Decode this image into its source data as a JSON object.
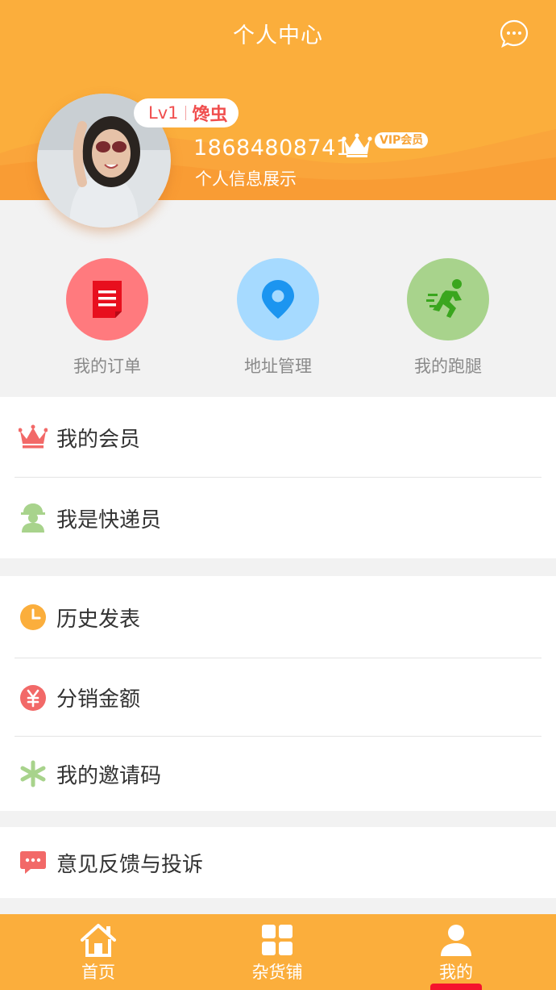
{
  "header": {
    "title": "个人中心",
    "message_icon": "chat-bubble-icon"
  },
  "profile": {
    "level": "Lv1",
    "nickname": "馋虫",
    "phone": "18684808741",
    "vip_badge": "VIP会员",
    "info": "个人信息展示"
  },
  "shortcuts": [
    {
      "label": "我的订单",
      "icon": "order-document-icon",
      "color": "#ff7a7e"
    },
    {
      "label": "地址管理",
      "icon": "location-pin-icon",
      "color": "#a6daff"
    },
    {
      "label": "我的跑腿",
      "icon": "running-man-icon",
      "color": "#a8d38c"
    }
  ],
  "menu": {
    "group1": [
      {
        "label": "我的会员",
        "icon": "crown-icon"
      },
      {
        "label": "我是快递员",
        "icon": "courier-icon"
      }
    ],
    "group2": [
      {
        "label": "历史发表",
        "icon": "clock-icon"
      },
      {
        "label": "分销金额",
        "icon": "yen-icon"
      },
      {
        "label": "我的邀请码",
        "icon": "asterisk-icon"
      }
    ],
    "group3": [
      {
        "label": "意见反馈与投诉",
        "icon": "feedback-chat-icon"
      }
    ]
  },
  "tabbar": [
    {
      "label": "首页",
      "icon": "home-icon",
      "active": false
    },
    {
      "label": "杂货铺",
      "icon": "grid-icon",
      "active": false
    },
    {
      "label": "我的",
      "icon": "user-icon",
      "active": true
    }
  ],
  "colors": {
    "brand_orange": "#fbae3c",
    "accent_red": "#f04e4e",
    "active_indicator": "#f5132d"
  }
}
